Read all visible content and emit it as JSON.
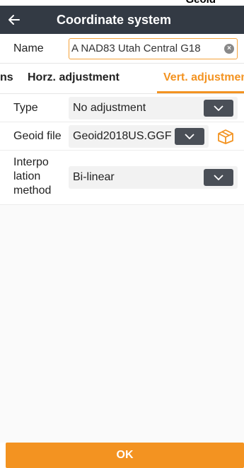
{
  "status_clip": "Geoid",
  "appbar": {
    "title": "Coordinate system",
    "back_icon": "arrow-left-icon"
  },
  "name_row": {
    "label": "Name",
    "value": "A NAD83 Utah Central G18",
    "clear_icon": "clear-circle-icon"
  },
  "tabs": [
    {
      "label": "ns",
      "active": false
    },
    {
      "label": "Horz. adjustment",
      "active": false
    },
    {
      "label": "Vert. adjustment",
      "active": true
    }
  ],
  "type_row": {
    "label": "Type",
    "value": "No adjustment"
  },
  "geoid_row": {
    "label": "Geoid file",
    "value": "Geoid2018US.GGF",
    "box_icon": "package-icon"
  },
  "interp_row": {
    "label_lines": [
      "Interpo",
      "lation",
      "method"
    ],
    "value": "Bi-linear"
  },
  "ok_button": {
    "label": "OK"
  },
  "colors": {
    "accent": "#f39321",
    "appbar": "#333a44",
    "dropdown_button": "#4a4f57"
  }
}
